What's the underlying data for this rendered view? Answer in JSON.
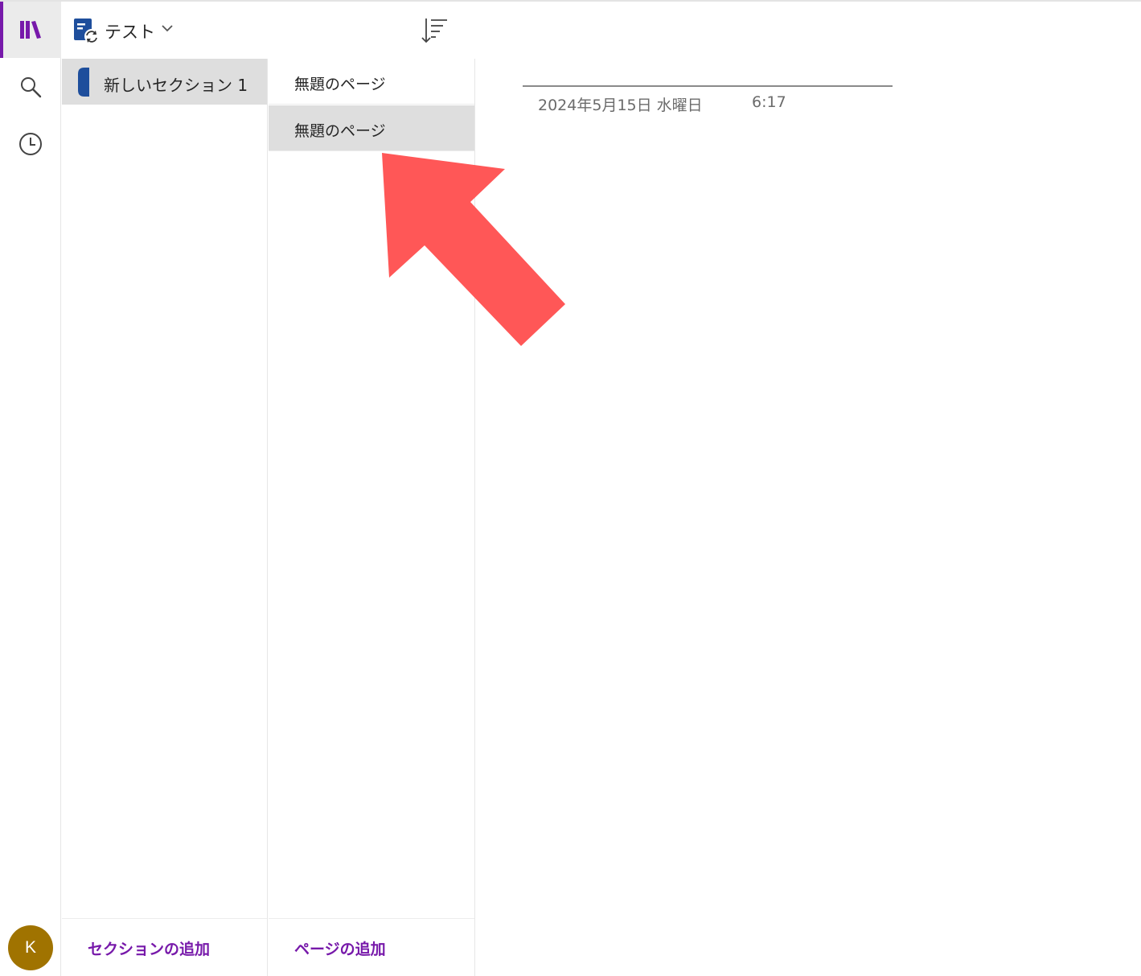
{
  "notebook": {
    "name": "テスト"
  },
  "sections": [
    {
      "label": "新しいセクション 1",
      "color": "#1e4e9c",
      "selected": true
    }
  ],
  "pages": [
    {
      "label": "無題のページ",
      "selected": false
    },
    {
      "label": "無題のページ",
      "selected": true
    }
  ],
  "footer": {
    "add_section": "セクションの追加",
    "add_page": "ページの追加"
  },
  "page_content": {
    "date": "2024年5月15日 水曜日",
    "time": "6:17"
  },
  "user": {
    "initial": "K",
    "avatar_color": "#a07300"
  },
  "rail": {
    "items": [
      "notebooks-icon",
      "search-icon",
      "recent-icon"
    ]
  },
  "colors": {
    "accent": "#7719aa",
    "selected_bg": "#dedede",
    "annotation_arrow": "#ff5757"
  }
}
